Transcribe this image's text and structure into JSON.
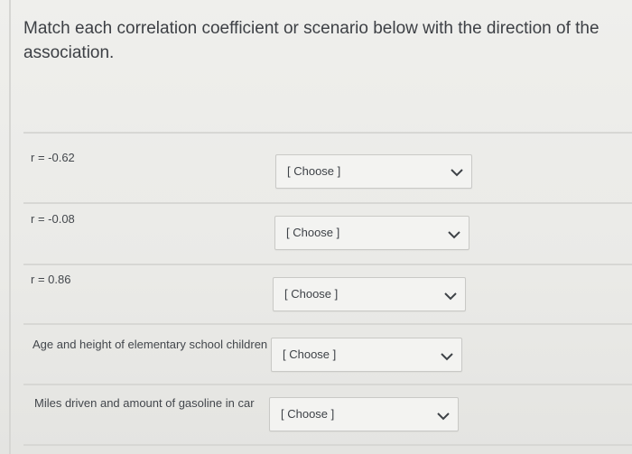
{
  "question": {
    "prompt": "Match each correlation coefficient or scenario below with the direction of the association."
  },
  "items": [
    {
      "label": "r = -0.62",
      "select_value": "[ Choose ]"
    },
    {
      "label": "r = -0.08",
      "select_value": "[ Choose ]"
    },
    {
      "label": "r = 0.86",
      "select_value": "[ Choose ]"
    },
    {
      "label": "Age and height of elementary school children",
      "select_value": "[ Choose ]"
    },
    {
      "label": "Miles driven and amount of gasoline in car",
      "select_value": "[ Choose ]"
    }
  ],
  "icons": {
    "dropdown": "chevron-down-icon"
  },
  "colors": {
    "background": "#eaeae7",
    "text": "#3d4045",
    "border": "#c9c9c6"
  }
}
